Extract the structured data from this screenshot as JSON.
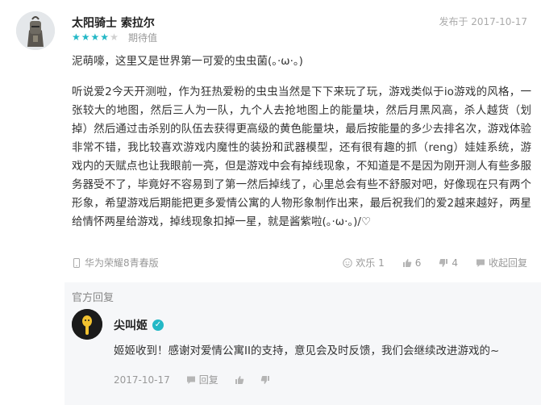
{
  "review": {
    "username": "太阳骑士 索拉尔",
    "rating": 4,
    "rating_max": 5,
    "rating_label": "期待值",
    "post_time": "发布于 2017-10-17",
    "paragraph1": "泥萌嚎，这里又是世界第一可爱的虫虫菌(。·ω·。)",
    "paragraph2": "听说爱2今天开测啦，作为狂热爱粉的虫虫当然是下下来玩了玩，游戏类似于io游戏的风格，一张较大的地图，然后三人为一队，九个人去抢地图上的能量块，然后月黑风高，杀人越货（划掉）然后通过击杀别的队伍去获得更高级的黄色能量块，最后按能量的多少去排名次，游戏体验非常不错，我比较喜欢游戏内魔性的装扮和武器模型，还有很有趣的抓（reng）娃娃系统，游戏内的天赋点也让我眼前一亮，但是游戏中会有掉线现象，不知道是不是因为刚开测人有些多服务器受不了，毕竟好不容易到了第一然后掉线了，心里总会有些不舒服对吧，好像现在只有两个形象，希望游戏后期能把更多爱情公寓的人物形象制作出来，最后祝我们的爱2越来越好，两星给情怀两星给游戏，掉线现象扣掉一星，就是酱紫啦(。·ω·。)/♡",
    "device": "华为荣耀8青春版",
    "actions": {
      "joy": "欢乐 1",
      "like": "6",
      "dislike": "4",
      "collapse": "收起回复"
    }
  },
  "reply": {
    "section_title": "官方回复",
    "name": "尖叫姬",
    "verified_mark": "✓",
    "text": "姬姬收到！感谢对爱情公寓II的支持，意见会及时反馈，我们会继续改进游戏的~",
    "time": "2017-10-17",
    "reply_label": "回复"
  },
  "colors": {
    "accent": "#23b8c6",
    "muted": "#999999",
    "reply_bg": "#f6f7f9"
  },
  "icons": [
    "avatar",
    "star-icon",
    "phone-icon",
    "emoji-icon",
    "thumbs-up-icon",
    "thumbs-down-icon",
    "comment-icon",
    "verified-icon"
  ]
}
